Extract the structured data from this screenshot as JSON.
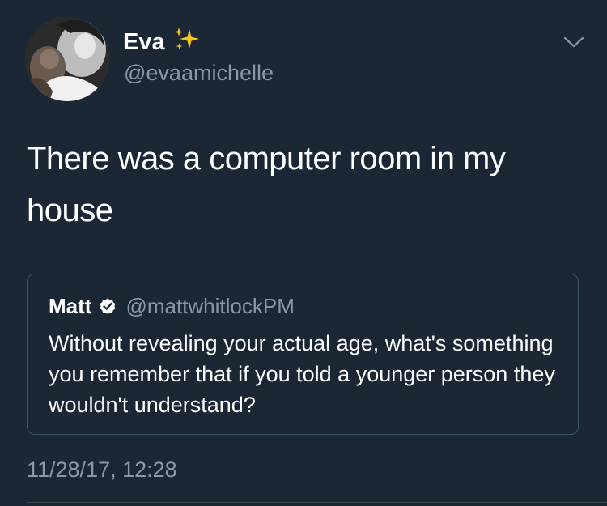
{
  "author": {
    "display_name": "Eva",
    "handle": "@evaamichelle",
    "name_emoji": "sparkles-icon"
  },
  "tweet": {
    "text": "There was a computer room in my house"
  },
  "quoted_tweet": {
    "display_name": "Matt",
    "handle": "@mattwhitlockPM",
    "verified": true,
    "text": "Without revealing your actual age, what's something you remember that if you told a younger person they wouldn't understand?"
  },
  "timestamp": "11/28/17, 12:28",
  "colors": {
    "background": "#1b2735",
    "secondary_text": "#8899a6",
    "card_border": "#3d5466",
    "sparkle": "#f5c518"
  }
}
